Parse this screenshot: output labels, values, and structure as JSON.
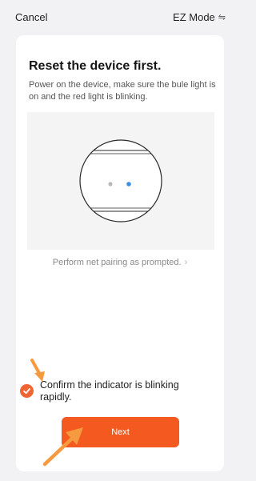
{
  "header": {
    "cancel_label": "Cancel",
    "mode_label": "EZ Mode",
    "mode_icon": "swap-icon"
  },
  "card": {
    "title": "Reset the device first.",
    "description": "Power on the device, make sure the bule light is on and the red light is blinking.",
    "pairing_link": "Perform net pairing as prompted.",
    "confirm_text": "Confirm the indicator is blinking rapidly.",
    "confirm_checked": true,
    "next_label": "Next"
  },
  "colors": {
    "accent": "#f45a1f",
    "annotation_arrow": "#f59a3e",
    "blue_light": "#3a8ee6",
    "grey_light": "#b9b9b9"
  }
}
